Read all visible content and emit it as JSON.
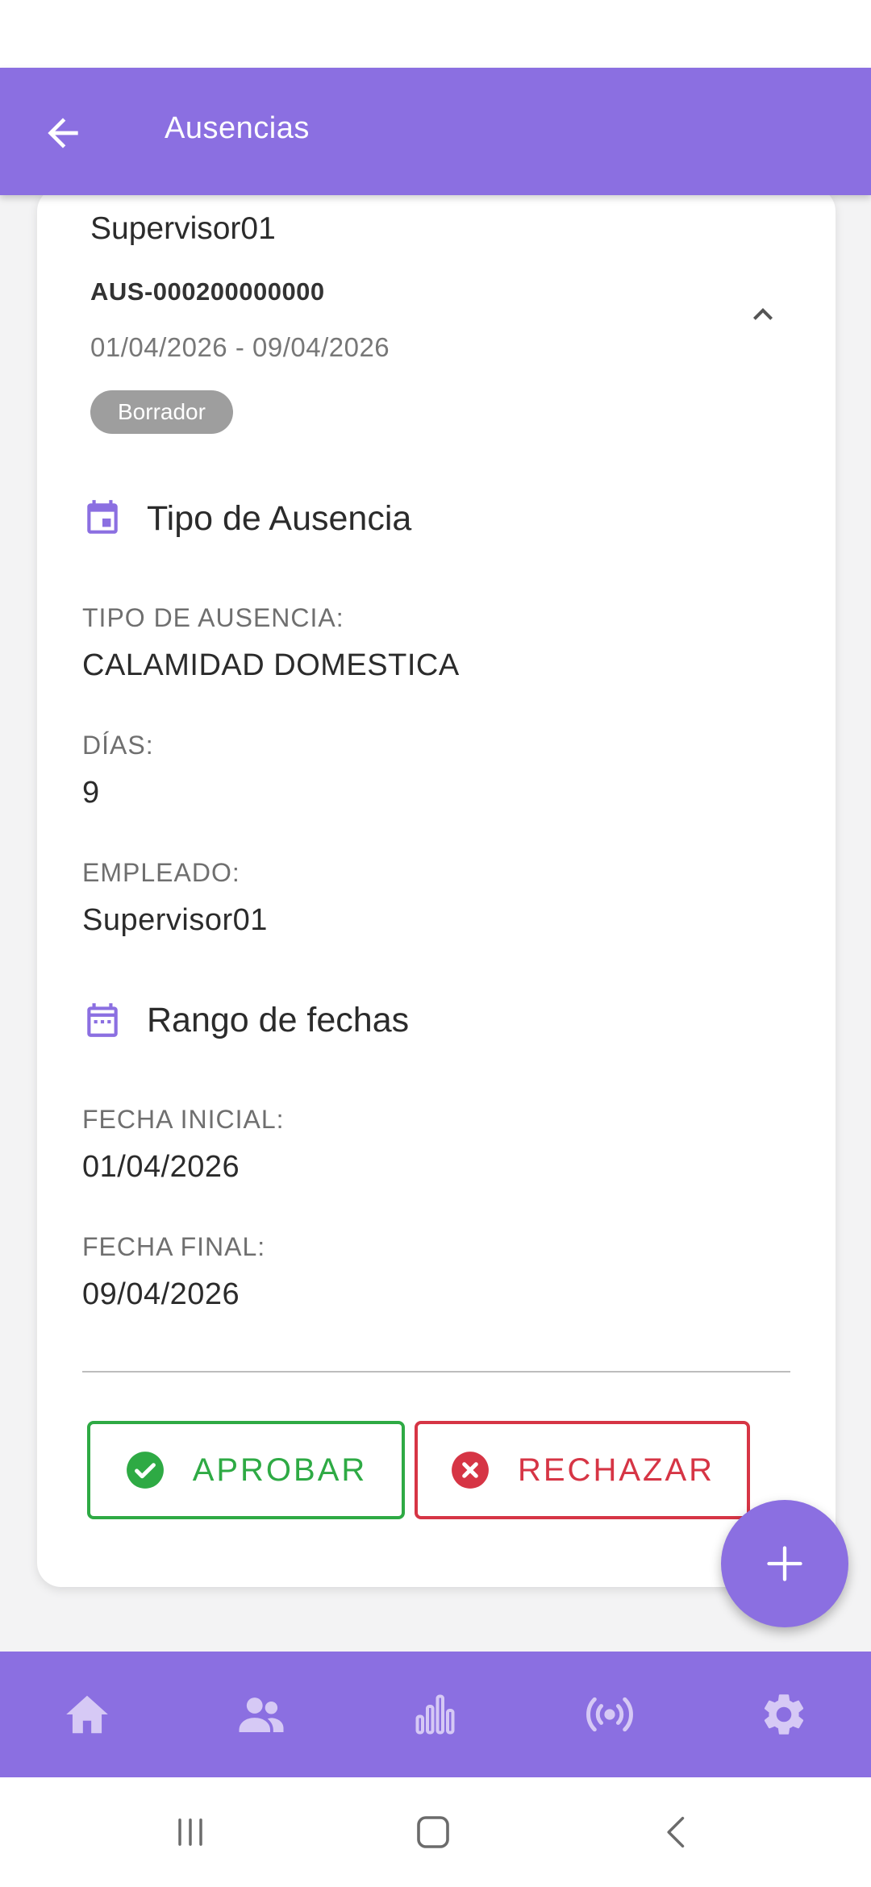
{
  "app_bar": {
    "title": "Ausencias",
    "back_icon": "arrow-left-icon"
  },
  "card": {
    "employee_name": "Supervisor01",
    "code": "AUS-000200000000",
    "date_range": "01/04/2026 - 09/04/2026",
    "status_badge": "Borrador",
    "collapse_icon": "chevron-up-icon"
  },
  "sections": {
    "absence_type": {
      "title": "Tipo de Ausencia",
      "icon": "calendar-event-icon",
      "fields": [
        {
          "label": "TIPO DE AUSENCIA:",
          "value": "CALAMIDAD DOMESTICA"
        },
        {
          "label": "DÍAS:",
          "value": "9"
        },
        {
          "label": "EMPLEADO:",
          "value": "Supervisor01"
        }
      ]
    },
    "date_range": {
      "title": "Rango de fechas",
      "icon": "calendar-month-icon",
      "fields": [
        {
          "label": "FECHA INICIAL:",
          "value": "01/04/2026"
        },
        {
          "label": "FECHA FINAL:",
          "value": "09/04/2026"
        }
      ]
    }
  },
  "actions": {
    "approve_label": "APROBAR",
    "reject_label": "RECHAZAR",
    "approve_color": "#2eaa44",
    "reject_color": "#d63545"
  },
  "fab": {
    "icon": "plus-icon"
  },
  "bottom_nav": {
    "items": [
      {
        "icon": "home-icon"
      },
      {
        "icon": "users-icon"
      },
      {
        "icon": "bar-chart-icon"
      },
      {
        "icon": "broadcast-icon"
      },
      {
        "icon": "settings-icon"
      }
    ]
  },
  "system_nav": {
    "recents_icon": "recents-icon",
    "home_icon": "system-home-icon",
    "back_icon": "system-back-icon"
  },
  "colors": {
    "primary": "#8b6fe1",
    "badge_gray": "#9e9e9e"
  }
}
